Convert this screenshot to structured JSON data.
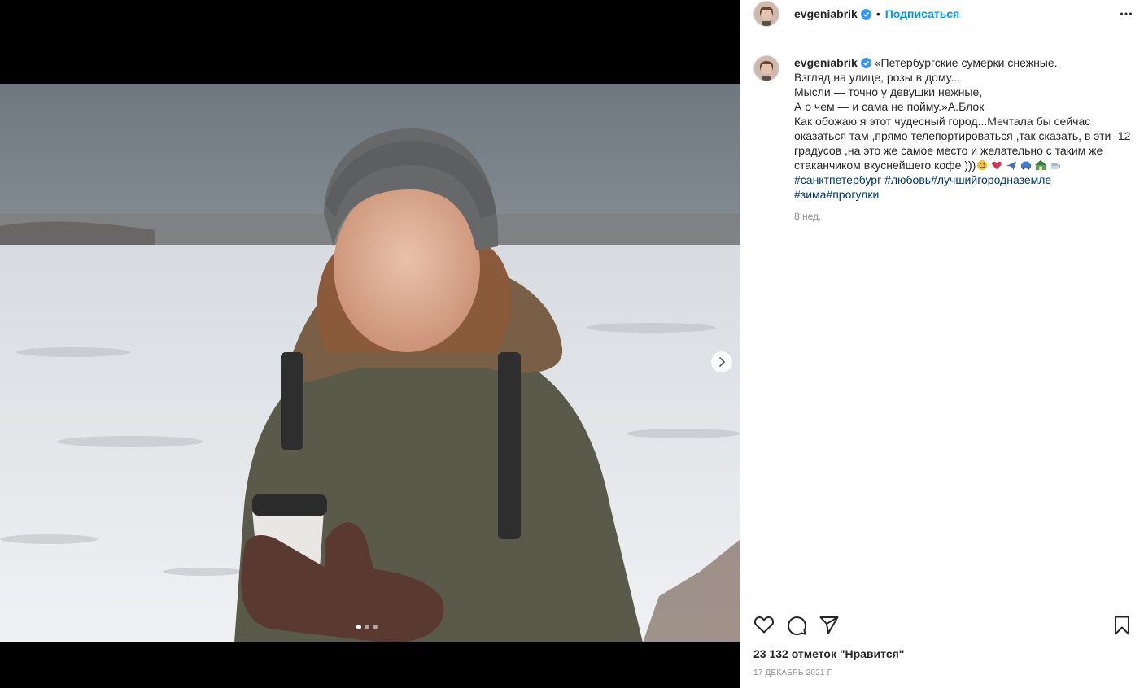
{
  "post": {
    "username": "evgeniabrik",
    "separator": "•",
    "follow_label": "Подписаться",
    "caption_lines": [
      "«Петербургские сумерки снежные.",
      "Взгляд на улице, розы в дому...",
      "Мысли — точно у девушки нежные,",
      "А о чем — и сама не пойму.»А.Блок",
      "Как обожаю я этот чудесный город...Мечтала бы сейчас",
      "оказаться там ,прямо телепортироваться ,так сказать, в эти -12",
      "градусов ,на это же самое место и желательно с таким же",
      "стаканчиком вкуснейшего кофе )))"
    ],
    "hashtags_line1": [
      "#санктпетербург",
      "#любовь",
      "#лучшийгородназемле"
    ],
    "hashtags_line2": [
      "#зима",
      "#прогулки"
    ],
    "time_ago": "8 нед.",
    "likes_text": "23 132 отметок \"Нравится\"",
    "date_text": "17 ДЕКАБРЬ 2021 Г.",
    "carousel": {
      "count": 3,
      "active": 1
    }
  },
  "icons": {
    "like": "heart-icon",
    "comment": "comment-icon",
    "share": "send-icon",
    "save": "bookmark-icon",
    "more": "more-horizontal-icon",
    "next": "chevron-right-icon",
    "verified": "verified-badge-icon"
  },
  "colors": {
    "link": "#0095f6",
    "hashtag": "#00376b",
    "muted": "#8e8e8e",
    "verified": "#3897f0"
  }
}
